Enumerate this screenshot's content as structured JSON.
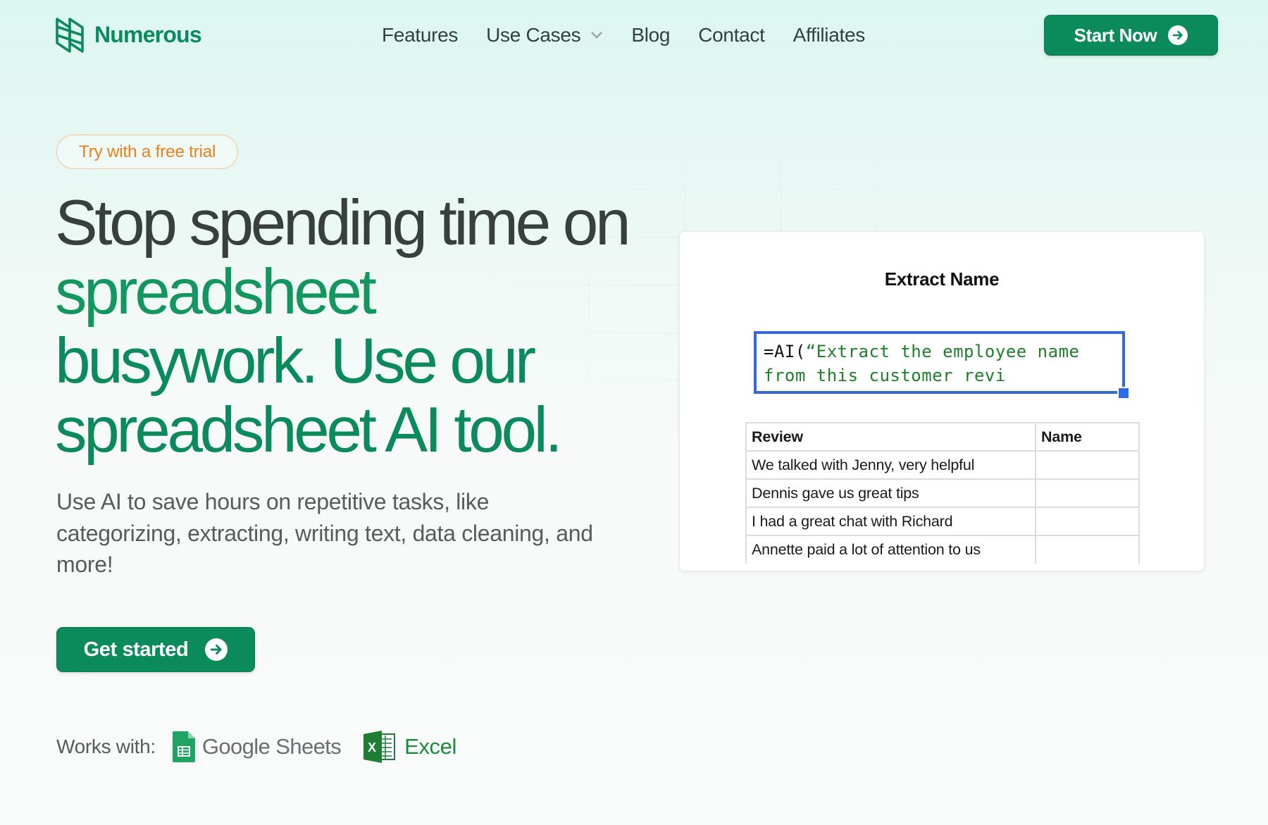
{
  "brand": {
    "name": "Numerous",
    "color": "#0b8a5c"
  },
  "nav": {
    "items": [
      {
        "label": "Features"
      },
      {
        "label": "Use Cases",
        "has_dropdown": true
      },
      {
        "label": "Blog"
      },
      {
        "label": "Contact"
      },
      {
        "label": "Affiliates"
      }
    ],
    "cta_label": "Start Now"
  },
  "hero": {
    "badge": "Try with a free trial",
    "headline": {
      "part1": "Stop spending time on ",
      "part2": "spreadsheet",
      "part3": " busywork. Use our spreadsheet AI tool."
    },
    "subtitle": "Use AI to save hours on repetitive tasks, like categorizing, extracting, writing text, data cleaning, and more!",
    "cta_label": "Get started",
    "works_with": {
      "label": "Works with:",
      "integrations": [
        {
          "name": "Google Sheets",
          "icon": "google-sheets-icon"
        },
        {
          "name": "Excel",
          "icon": "excel-icon"
        }
      ]
    }
  },
  "demo": {
    "title": "Extract Name",
    "formula": {
      "prefix": "=AI(",
      "text": "“Extract the employee name from this customer revi"
    },
    "table": {
      "headers": [
        "Review",
        "Name"
      ],
      "rows": [
        [
          "We talked with Jenny, very helpful",
          ""
        ],
        [
          "Dennis gave us great tips",
          ""
        ],
        [
          "I had a great chat with Richard",
          ""
        ],
        [
          "Annette paid a lot of attention to us",
          ""
        ]
      ]
    }
  },
  "colors": {
    "primary": "#0b8a5c",
    "badge": "#e8821c",
    "formula_border": "#3a66d8",
    "text_dark": "#383f3c"
  }
}
